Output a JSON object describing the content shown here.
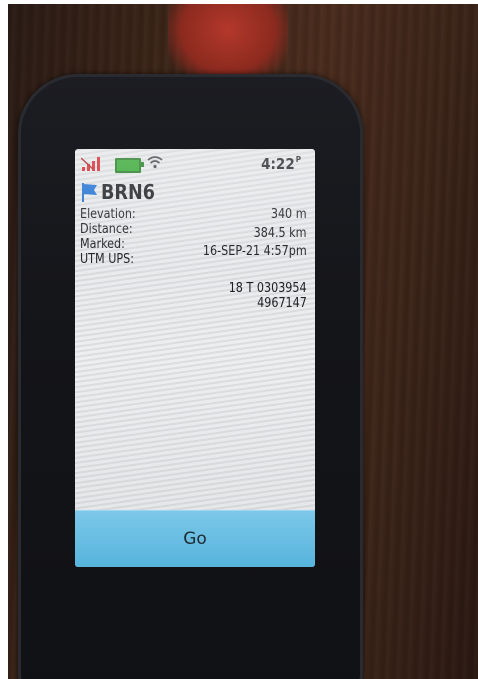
{
  "status_bar": {
    "time": "4:22",
    "time_suffix": "P",
    "icons": [
      "signal-icon",
      "battery-icon",
      "wifi-icon"
    ]
  },
  "waypoint": {
    "name": "BRN6",
    "icon": "flag-icon"
  },
  "details": {
    "elevation_label": "Elevation:",
    "elevation_value": "340 m",
    "distance_label": "Distance:",
    "distance_value": "384.5 km",
    "marked_label": "Marked:",
    "marked_value": "16-SEP-21 4:57pm",
    "utm_label": "UTM UPS:",
    "utm_zone": "18  T 0303954",
    "utm_northing": "4967147"
  },
  "actions": {
    "go_label": "Go"
  },
  "colors": {
    "go_bar": "#56b4dd",
    "flag": "#1f6fd1",
    "battery": "#2ea52e",
    "signal": "#d2232a"
  }
}
